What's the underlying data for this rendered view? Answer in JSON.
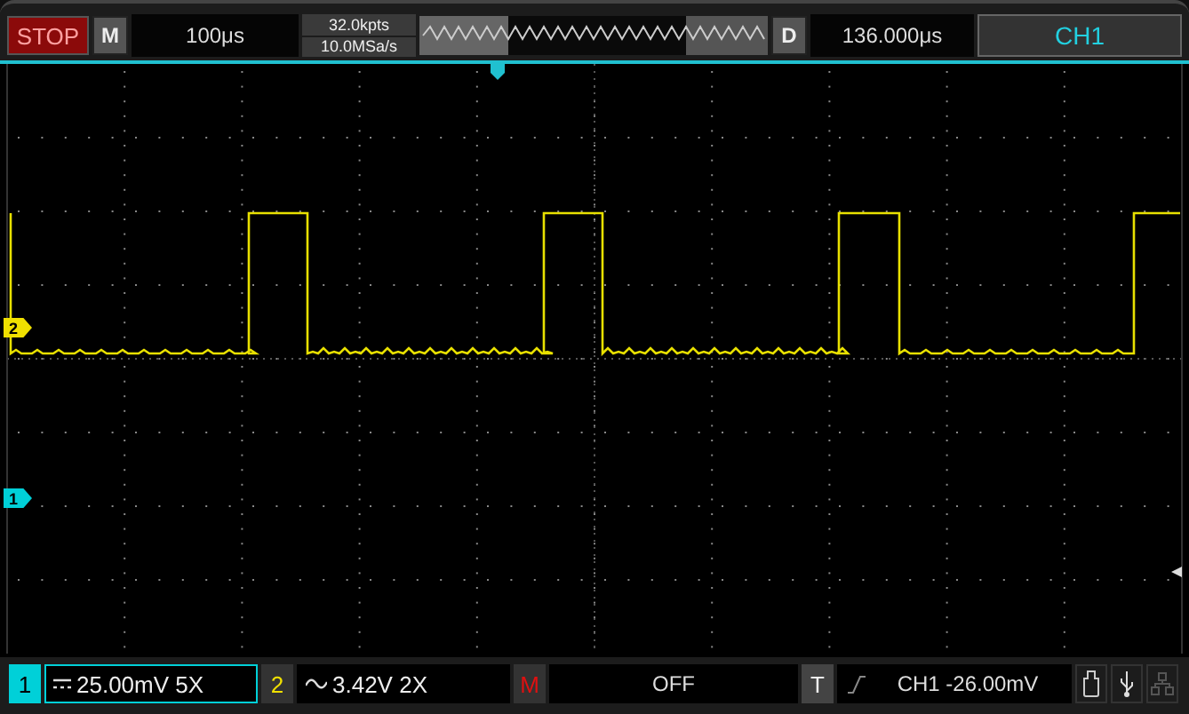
{
  "top_bar": {
    "run_button": {
      "label": "STOP",
      "running": false
    },
    "menu_key": "M",
    "timebase": "100μs",
    "memory_depth": "32.0kpts",
    "sample_rate": "10.0MSa/s",
    "delay_key": "D",
    "delay": "136.000μs",
    "trigger_source": "CH1"
  },
  "markers": [
    {
      "label": "2",
      "color": "#f0e000"
    },
    {
      "label": "1",
      "color": "#00d0d8"
    }
  ],
  "channels": [
    {
      "badge": "1",
      "kind": "dc",
      "scale": "25.00mV 5X",
      "color": "#00d0d8",
      "selected": true
    },
    {
      "badge": "2",
      "kind": "ac",
      "scale": "3.42V 2X",
      "color": "#f0e000",
      "selected": false
    }
  ],
  "math": {
    "badge": "M",
    "value": "OFF"
  },
  "trigger": {
    "badge": "T",
    "kind": "rising",
    "level": "CH1 -26.00mV"
  }
}
